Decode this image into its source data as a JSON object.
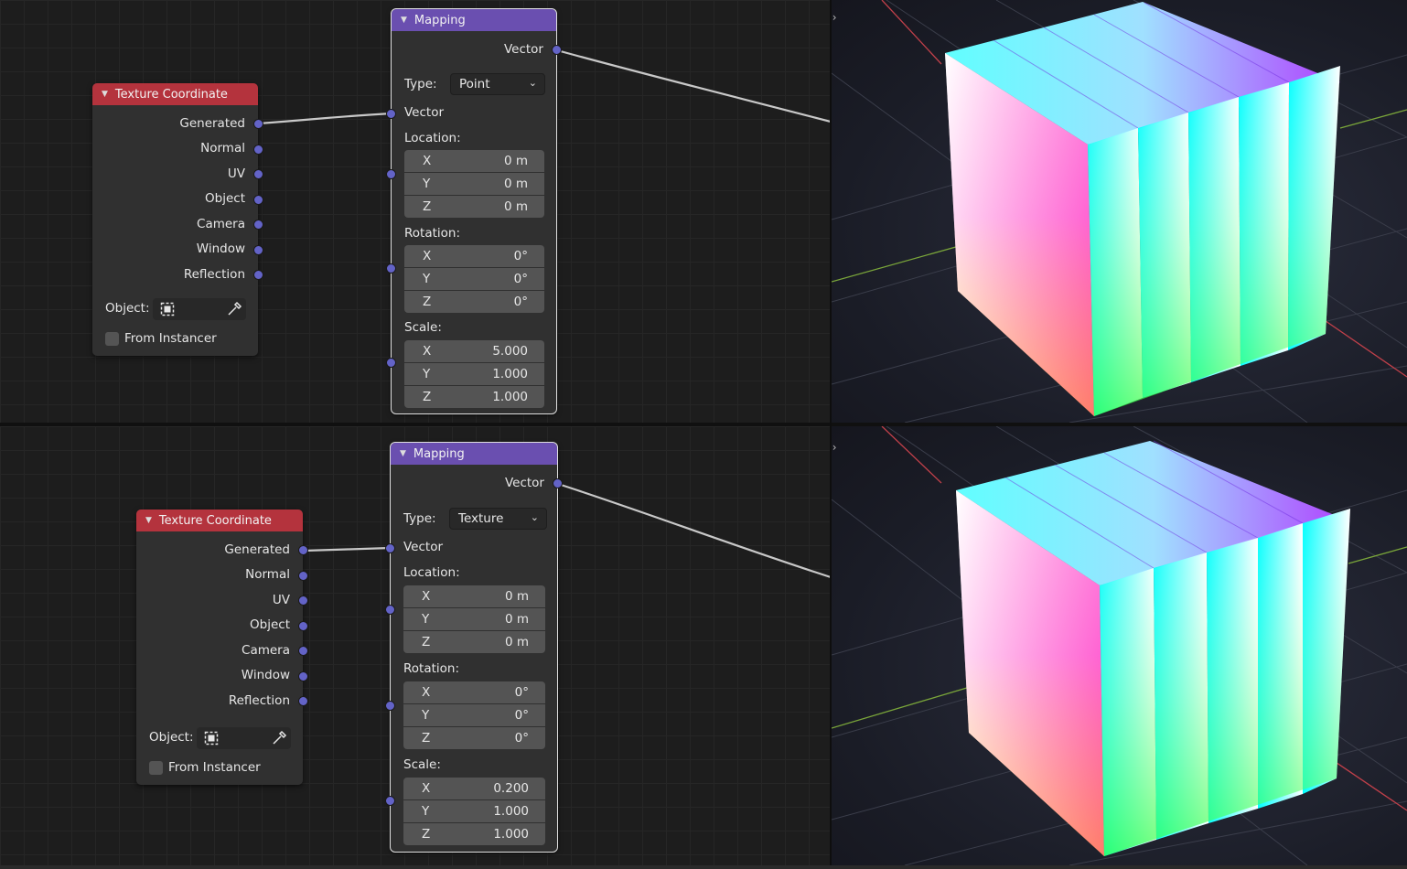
{
  "top": {
    "texture_coordinate": {
      "title": "Texture Coordinate",
      "outputs": [
        "Generated",
        "Normal",
        "UV",
        "Object",
        "Camera",
        "Window",
        "Reflection"
      ],
      "object_label": "Object:",
      "from_instancer": "From Instancer"
    },
    "mapping": {
      "title": "Mapping",
      "output": "Vector",
      "type_label": "Type:",
      "type_value": "Point",
      "vector_input": "Vector",
      "location_label": "Location:",
      "location": [
        {
          "axis": "X",
          "value": "0 m"
        },
        {
          "axis": "Y",
          "value": "0 m"
        },
        {
          "axis": "Z",
          "value": "0 m"
        }
      ],
      "rotation_label": "Rotation:",
      "rotation": [
        {
          "axis": "X",
          "value": "0°"
        },
        {
          "axis": "Y",
          "value": "0°"
        },
        {
          "axis": "Z",
          "value": "0°"
        }
      ],
      "scale_label": "Scale:",
      "scale": [
        {
          "axis": "X",
          "value": "5.000"
        },
        {
          "axis": "Y",
          "value": "1.000"
        },
        {
          "axis": "Z",
          "value": "1.000"
        }
      ]
    }
  },
  "bottom": {
    "texture_coordinate": {
      "title": "Texture Coordinate",
      "outputs": [
        "Generated",
        "Normal",
        "UV",
        "Object",
        "Camera",
        "Window",
        "Reflection"
      ],
      "object_label": "Object:",
      "from_instancer": "From Instancer"
    },
    "mapping": {
      "title": "Mapping",
      "output": "Vector",
      "type_label": "Type:",
      "type_value": "Texture",
      "vector_input": "Vector",
      "location_label": "Location:",
      "location": [
        {
          "axis": "X",
          "value": "0 m"
        },
        {
          "axis": "Y",
          "value": "0 m"
        },
        {
          "axis": "Z",
          "value": "0 m"
        }
      ],
      "rotation_label": "Rotation:",
      "rotation": [
        {
          "axis": "X",
          "value": "0°"
        },
        {
          "axis": "Y",
          "value": "0°"
        },
        {
          "axis": "Z",
          "value": "0°"
        }
      ],
      "scale_label": "Scale:",
      "scale": [
        {
          "axis": "X",
          "value": "0.200"
        },
        {
          "axis": "Y",
          "value": "1.000"
        },
        {
          "axis": "Z",
          "value": "1.000"
        }
      ]
    }
  },
  "icons": {
    "collapse": "triangle-down-icon",
    "object_picker": "object-square-icon",
    "eyedropper": "eyedropper-icon",
    "dropdown": "chevron-down-icon",
    "area_toggle": "arrows-left-right-icon"
  },
  "colors": {
    "texcoord_header": "#b4333d",
    "mapping_header": "#6a4fb0",
    "socket_vector": "#6363c7",
    "x_axis": "#c0404a",
    "y_axis": "#7aa63a"
  }
}
